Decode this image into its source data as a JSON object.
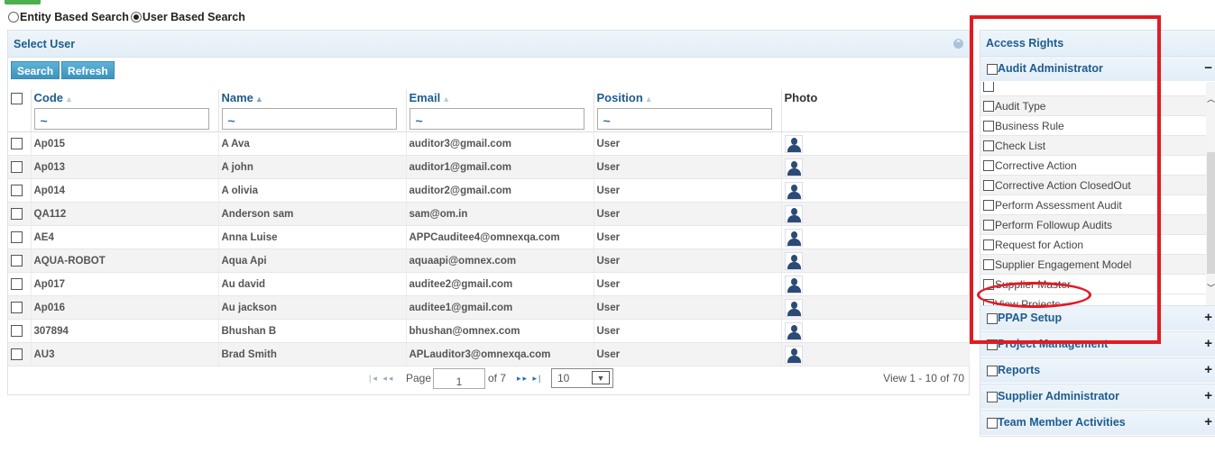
{
  "search_mode": {
    "options": [
      {
        "label": "Entity Based Search",
        "selected": false
      },
      {
        "label": "User Based Search",
        "selected": true
      }
    ]
  },
  "select_user": {
    "title": "Select User",
    "search_label": "Search",
    "refresh_label": "Refresh",
    "columns": [
      "Code",
      "Name",
      "Email",
      "Position",
      "Photo"
    ],
    "filter_values": [
      "~",
      "~",
      "~",
      "~"
    ],
    "rows": [
      {
        "code": "Ap015",
        "name": "A Ava",
        "email": "auditor3@gmail.com",
        "position": "User"
      },
      {
        "code": "Ap013",
        "name": "A john",
        "email": "auditor1@gmail.com",
        "position": "User"
      },
      {
        "code": "Ap014",
        "name": "A olivia",
        "email": "auditor2@gmail.com",
        "position": "User"
      },
      {
        "code": "QA112",
        "name": "Anderson sam",
        "email": "sam@om.in",
        "position": "User"
      },
      {
        "code": "AE4",
        "name": "Anna Luise",
        "email": "APPCauditee4@omnexqa.com",
        "position": "User"
      },
      {
        "code": "AQUA-ROBOT",
        "name": "Aqua Api",
        "email": "aquaapi@omnex.com",
        "position": "User"
      },
      {
        "code": "Ap017",
        "name": "Au david",
        "email": "auditee2@gmail.com",
        "position": "User"
      },
      {
        "code": "Ap016",
        "name": "Au jackson",
        "email": "auditee1@gmail.com",
        "position": "User"
      },
      {
        "code": "307894",
        "name": "Bhushan B",
        "email": "bhushan@omnex.com",
        "position": "User"
      },
      {
        "code": "AU3",
        "name": "Brad Smith",
        "email": "APLauditor3@omnexqa.com",
        "position": "User"
      }
    ],
    "pager": {
      "page_label": "Page",
      "page_value": "1",
      "of_label": "of 7",
      "page_size": "10",
      "view_text": "View 1 - 10 of 70"
    }
  },
  "access_rights": {
    "title": "Access Rights",
    "groups": [
      {
        "label": "Audit Administrator",
        "toggle": "−"
      },
      {
        "label": "PPAP Setup",
        "toggle": "+"
      },
      {
        "label": "Project Management",
        "toggle": "+"
      },
      {
        "label": "Reports",
        "toggle": "+"
      },
      {
        "label": "Supplier Administrator",
        "toggle": "+"
      },
      {
        "label": "Team Member Activities",
        "toggle": "+"
      }
    ],
    "audit_items": [
      "Audit Type",
      "Business Rule",
      "Check List",
      "Corrective Action",
      "Corrective Action ClosedOut",
      "Perform Assessment Audit",
      "Perform Followup Audits",
      "Request for Action",
      "Supplier Engagement Model",
      "Supplier Master",
      "View Projects"
    ]
  },
  "colors": {
    "accent": "#1e5c8e",
    "button": "#4aa3cb",
    "annotation": "#e21b23"
  }
}
